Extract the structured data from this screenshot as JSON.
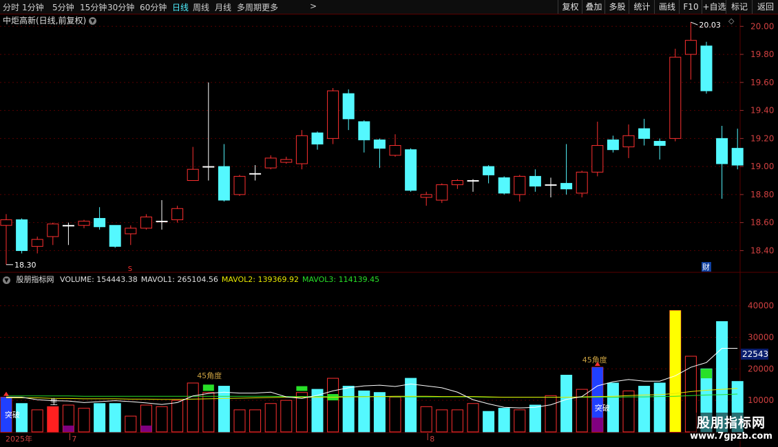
{
  "toolbar": {
    "periods": [
      "分时",
      "1分钟",
      "5分钟",
      "15分钟",
      "30分钟",
      "60分钟",
      "日线",
      "周线",
      "月线",
      "多周期",
      "更多"
    ],
    "active_period": "日线",
    "more_arrow": ">",
    "right_buttons": [
      "复权",
      "叠加",
      "多股",
      "统计",
      "画线",
      "F10",
      "+自选",
      "标记",
      "返回"
    ]
  },
  "title": {
    "text": "中炬高新(日线,前复权)"
  },
  "price_axis": {
    "labels": [
      "20.00",
      "19.80",
      "19.60",
      "19.40",
      "19.20",
      "19.00",
      "18.80",
      "18.60",
      "18.40"
    ],
    "range": [
      18.25,
      20.08
    ]
  },
  "volume_axis": {
    "labels": [
      "40000",
      "30000",
      "20000",
      "10000"
    ],
    "current": "22543",
    "range": [
      0,
      48000
    ]
  },
  "annotations": {
    "high": "20.03",
    "low": "18.30",
    "cai": "财",
    "s_marker": "S",
    "angle": "45角度",
    "tupo": "突破",
    "sheng": "生",
    "year": "2025年",
    "month7": "7",
    "month8": "8"
  },
  "indicator": {
    "name": "股朋指标网",
    "items": [
      {
        "label": "VOLUME: 154443.38",
        "color": "#e0e0e0"
      },
      {
        "label": "MAVOL1: 265104.56",
        "color": "#e0e0e0"
      },
      {
        "label": "MAVOL2: 139369.92",
        "color": "#e8e800"
      },
      {
        "label": "MAVOL3: 114139.45",
        "color": "#28e028"
      }
    ]
  },
  "watermark": {
    "title": "股朋指标网",
    "url": "www.7gpzb.com"
  },
  "colors": {
    "up": "#ff3030",
    "down": "#54f8ff",
    "grid": "#5a0000",
    "ma1": "#ffffff",
    "ma2": "#e8e800",
    "ma3": "#28e028"
  },
  "chart_data": {
    "type": "candlestick",
    "candles": [
      [
        18.58,
        18.62,
        18.3,
        18.66
      ],
      [
        18.62,
        18.4,
        18.38,
        18.63
      ],
      [
        18.43,
        18.48,
        18.38,
        18.5
      ],
      [
        18.5,
        18.59,
        18.44,
        18.6
      ],
      [
        18.58,
        18.58,
        18.44,
        18.6
      ],
      [
        18.58,
        18.61,
        18.56,
        18.62
      ],
      [
        18.63,
        18.57,
        18.55,
        18.71
      ],
      [
        18.58,
        18.43,
        18.42,
        18.58
      ],
      [
        18.52,
        18.56,
        18.44,
        18.58
      ],
      [
        18.56,
        18.64,
        18.55,
        18.66
      ],
      [
        18.61,
        18.61,
        18.55,
        18.76
      ],
      [
        18.62,
        18.7,
        18.6,
        18.72
      ],
      [
        18.9,
        18.98,
        18.9,
        19.14
      ],
      [
        19.0,
        19.0,
        18.9,
        19.6
      ],
      [
        19.0,
        18.76,
        18.75,
        19.16
      ],
      [
        18.8,
        18.93,
        18.79,
        18.94
      ],
      [
        18.95,
        18.95,
        18.9,
        19.01
      ],
      [
        18.99,
        19.06,
        18.98,
        19.08
      ],
      [
        19.03,
        19.05,
        19.02,
        19.07
      ],
      [
        19.02,
        19.22,
        18.98,
        19.26
      ],
      [
        19.24,
        19.16,
        19.12,
        19.25
      ],
      [
        19.2,
        19.54,
        19.16,
        19.56
      ],
      [
        19.52,
        19.34,
        19.26,
        19.55
      ],
      [
        19.32,
        19.19,
        19.1,
        19.33
      ],
      [
        19.19,
        19.13,
        18.99,
        19.2
      ],
      [
        19.08,
        19.15,
        19.07,
        19.23
      ],
      [
        19.12,
        18.83,
        18.82,
        19.13
      ],
      [
        18.78,
        18.8,
        18.72,
        18.82
      ],
      [
        18.76,
        18.87,
        18.74,
        18.88
      ],
      [
        18.87,
        18.9,
        18.84,
        18.91
      ],
      [
        18.9,
        18.9,
        18.82,
        18.91
      ],
      [
        19.0,
        18.94,
        18.88,
        19.01
      ],
      [
        18.92,
        18.81,
        18.8,
        18.93
      ],
      [
        18.8,
        18.93,
        18.75,
        18.94
      ],
      [
        18.93,
        18.86,
        18.82,
        18.98
      ],
      [
        18.87,
        18.87,
        18.78,
        18.92
      ],
      [
        18.88,
        18.84,
        18.8,
        19.16
      ],
      [
        18.81,
        18.96,
        18.78,
        18.97
      ],
      [
        18.96,
        19.15,
        18.93,
        19.32
      ],
      [
        19.19,
        19.12,
        19.1,
        19.22
      ],
      [
        19.14,
        19.22,
        19.06,
        19.3
      ],
      [
        19.27,
        19.2,
        19.15,
        19.34
      ],
      [
        19.18,
        19.15,
        19.05,
        19.2
      ],
      [
        19.2,
        19.78,
        19.18,
        19.84
      ],
      [
        19.8,
        19.9,
        19.62,
        20.03
      ],
      [
        19.86,
        19.54,
        19.52,
        19.89
      ],
      [
        19.2,
        19.02,
        18.77,
        19.29
      ],
      [
        19.13,
        19.01,
        18.98,
        19.27
      ]
    ],
    "volume": [
      11000,
      9000,
      7000,
      8000,
      8500,
      7500,
      9000,
      9000,
      5000,
      8500,
      8000,
      10000,
      15500,
      12500,
      14500,
      7000,
      7000,
      9000,
      10000,
      12500,
      13500,
      17000,
      14500,
      13000,
      12500,
      11000,
      17000,
      8000,
      7000,
      7000,
      9000,
      6500,
      7500,
      7000,
      8500,
      11500,
      18000,
      13500,
      20500,
      15500,
      13000,
      14500,
      15500,
      38500,
      24000,
      20000,
      35000,
      16000
    ],
    "ma1": [
      11000,
      11000,
      10200,
      9900,
      9800,
      9300,
      9600,
      9900,
      9600,
      9200,
      8700,
      9300,
      11400,
      12200,
      12600,
      12300,
      12300,
      12600,
      11100,
      10600,
      11600,
      13000,
      14000,
      14600,
      14800,
      14400,
      15200,
      14600,
      14000,
      12600,
      10200,
      8900,
      7800,
      7600,
      7800,
      8600,
      10300,
      11200,
      14600,
      15900,
      16600,
      16100,
      16100,
      17800,
      20500,
      22000,
      26500,
      26500
    ],
    "ma2": [
      10800,
      10800,
      10800,
      10600,
      10600,
      10500,
      10500,
      10500,
      10400,
      10400,
      10300,
      10300,
      10400,
      10500,
      10600,
      10700,
      10800,
      10900,
      11000,
      11000,
      11000,
      11000,
      11100,
      11100,
      11200,
      11300,
      11300,
      11300,
      11200,
      11200,
      11200,
      11100,
      11000,
      11000,
      11000,
      11000,
      11000,
      11100,
      11200,
      11300,
      11500,
      11700,
      11800,
      12200,
      12800,
      13200,
      13500,
      13800
    ],
    "ma3": [
      11400,
      11400,
      11400,
      11400,
      11400,
      11300,
      11300,
      11300,
      11300,
      11300,
      11300,
      11300,
      11300,
      11300,
      11300,
      11300,
      11300,
      11300,
      11200,
      11200,
      11200,
      11200,
      11200,
      11200,
      11200,
      11100,
      11100,
      11100,
      11100,
      11100,
      11100,
      11000,
      11000,
      11000,
      11000,
      11000,
      11000,
      11000,
      11000,
      11000,
      11100,
      11100,
      11200,
      11300,
      11500,
      11700,
      11800,
      12000
    ]
  }
}
